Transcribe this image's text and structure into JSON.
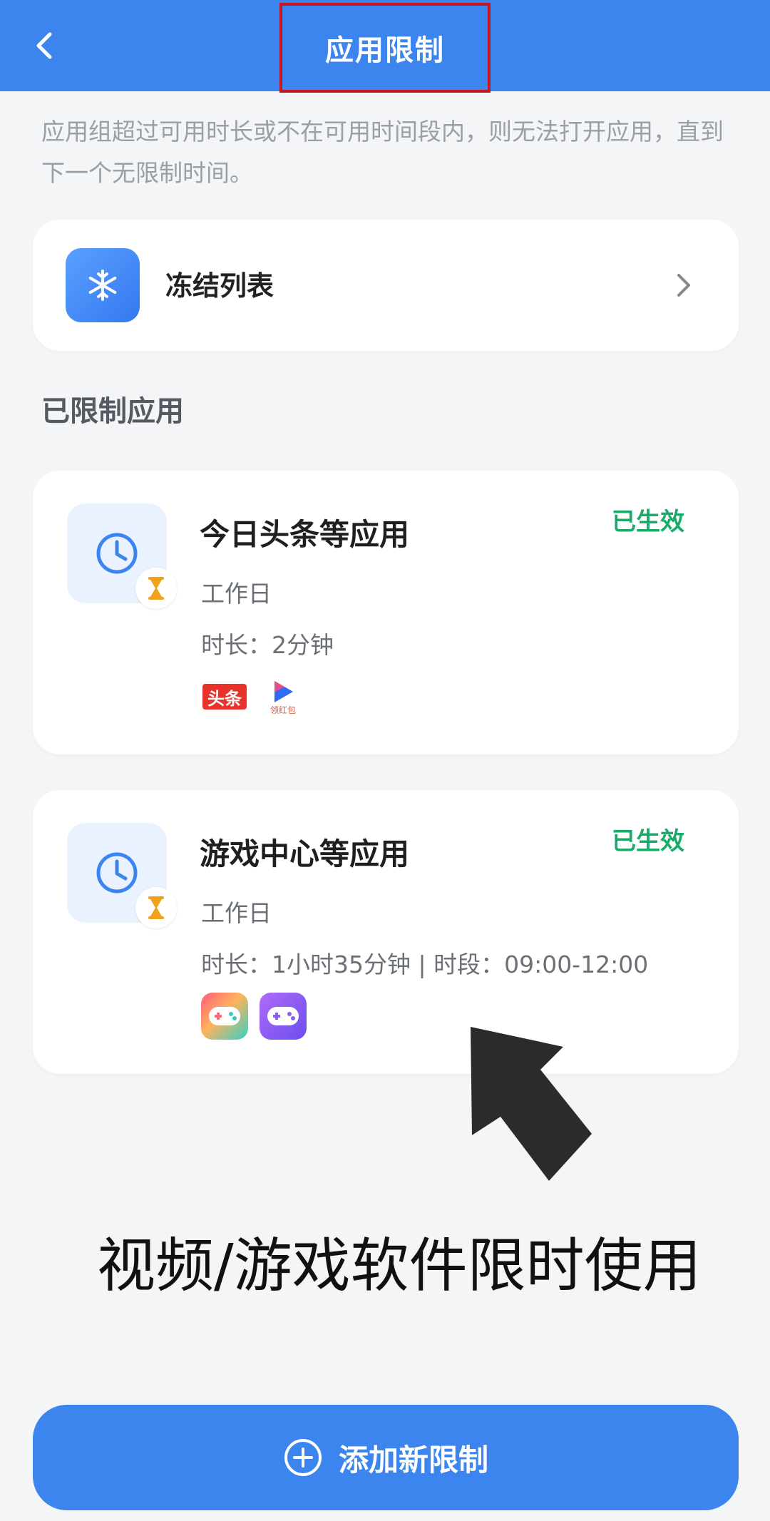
{
  "header": {
    "title": "应用限制"
  },
  "description": "应用组超过可用时长或不在可用时间段内，则无法打开应用，直到下一个无限制时间。",
  "freeze": {
    "label": "冻结列表"
  },
  "section_title": "已限制应用",
  "limits": [
    {
      "title": "今日头条等应用",
      "status": "已生效",
      "schedule": "工作日",
      "detail": "时长：2分钟",
      "apps": [
        {
          "icon": "toutiao-app-icon",
          "label": "头条"
        },
        {
          "icon": "video-app-icon",
          "label": "领红包"
        }
      ]
    },
    {
      "title": "游戏中心等应用",
      "status": "已生效",
      "schedule": "工作日",
      "detail": "时长：1小时35分钟 | 时段：09:00-12:00",
      "apps": [
        {
          "icon": "game-center-app-icon",
          "label": ""
        },
        {
          "icon": "gamepad-app-icon",
          "label": ""
        }
      ]
    }
  ],
  "caption": "视频/游戏软件限时使用",
  "add_button": {
    "label": "添加新限制"
  },
  "colors": {
    "primary": "#3d85ee",
    "status_green": "#1aaa6a",
    "highlight_red": "#c8161d"
  }
}
